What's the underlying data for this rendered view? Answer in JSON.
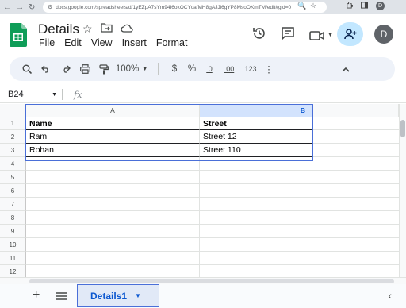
{
  "browser": {
    "url": "docs.google.com/spreadsheets/d/1yEZpA7sYm94I6okOCYcafMH8gAJJl6gYP8MsoOKmTM/edit#gid=0",
    "profile_initial": "D"
  },
  "document": {
    "title": "Details",
    "menu": [
      "File",
      "Edit",
      "View",
      "Insert",
      "Format"
    ],
    "user_initial": "D"
  },
  "toolbar": {
    "zoom": "100%",
    "currency": "$",
    "percent": "%",
    "decimal_decrease": ".0",
    "decimal_increase": ".00",
    "number_format": "123"
  },
  "formula_bar": {
    "name_box": "B24",
    "fx_label": "fx"
  },
  "grid": {
    "columns": [
      "A",
      "B"
    ],
    "rows": [
      "1",
      "2",
      "3",
      "4",
      "5",
      "6",
      "7",
      "8",
      "9",
      "10",
      "11",
      "12"
    ],
    "cells": [
      [
        "Name",
        "Street"
      ],
      [
        "Ram",
        "Street 12"
      ],
      [
        "Rohan",
        "Street 110"
      ]
    ]
  },
  "sheets": {
    "active_tab": "Details1"
  },
  "colors": {
    "accent": "#0b57d0",
    "selection_border": "#4a6fd8",
    "share_bg": "#c2e7ff",
    "sheets_green": "#0f9d58"
  }
}
